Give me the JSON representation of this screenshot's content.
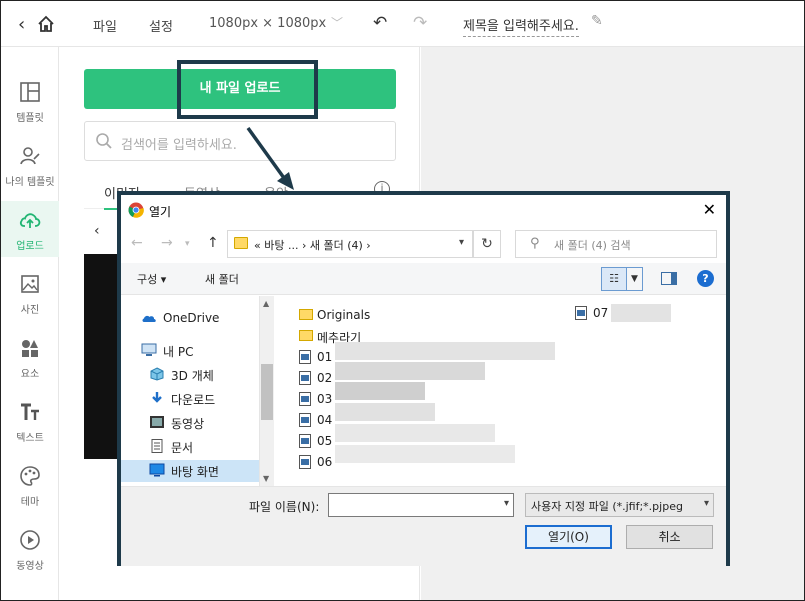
{
  "topbar": {
    "menu_file": "파일",
    "menu_settings": "설정",
    "canvas_size": "1080px × 1080px",
    "title_placeholder": "제목을 입력해주세요."
  },
  "leftnav": {
    "items": [
      {
        "label": "템플릿",
        "icon": "template-icon"
      },
      {
        "label": "나의 템플릿",
        "icon": "my-template-icon"
      },
      {
        "label": "업로드",
        "icon": "upload-cloud-icon",
        "active": true
      },
      {
        "label": "사진",
        "icon": "photo-icon"
      },
      {
        "label": "요소",
        "icon": "elements-icon"
      },
      {
        "label": "텍스트",
        "icon": "text-icon"
      },
      {
        "label": "테마",
        "icon": "palette-icon"
      },
      {
        "label": "동영상",
        "icon": "video-play-icon"
      }
    ]
  },
  "panel": {
    "upload_button": "내 파일 업로드",
    "search_placeholder": "검색어를 입력하세요.",
    "tabs": [
      "이미지",
      "동영상",
      "음악"
    ],
    "info_symbol": "i"
  },
  "dialog": {
    "title": "열기",
    "address_path": "« 바탕 ...  ›  새 폴더 (4)  ›",
    "search_placeholder": "새 폴더 (4) 검색",
    "organize": "구성 ▾",
    "new_folder": "새 폴더",
    "nav_items": [
      {
        "label": "OneDrive",
        "icon": "onedrive-icon"
      },
      {
        "label": "내 PC",
        "icon": "pc-icon"
      },
      {
        "label": "3D 개체",
        "icon": "3d-objects-icon"
      },
      {
        "label": "다운로드",
        "icon": "download-icon"
      },
      {
        "label": "동영상",
        "icon": "video-folder-icon"
      },
      {
        "label": "문서",
        "icon": "document-icon"
      },
      {
        "label": "바탕 화면",
        "icon": "desktop-icon",
        "selected": true
      }
    ],
    "files": [
      {
        "name": "Originals",
        "type": "folder"
      },
      {
        "name": "메추라기",
        "type": "folder"
      },
      {
        "name": "01",
        "type": "image"
      },
      {
        "name": "02",
        "type": "image"
      },
      {
        "name": "03",
        "type": "image"
      },
      {
        "name": "04",
        "type": "image"
      },
      {
        "name": "05",
        "type": "image"
      },
      {
        "name": "06",
        "type": "image"
      },
      {
        "name": "07",
        "type": "image"
      }
    ],
    "filename_label": "파일 이름(N):",
    "filename_value": "",
    "filter": "사용자 지정 파일 (*.jfif;*.pjpeg",
    "open_button": "열기(O)",
    "cancel_button": "취소"
  },
  "colors": {
    "accent_green": "#2ec27e",
    "highlight_border": "#1e3a4a"
  }
}
